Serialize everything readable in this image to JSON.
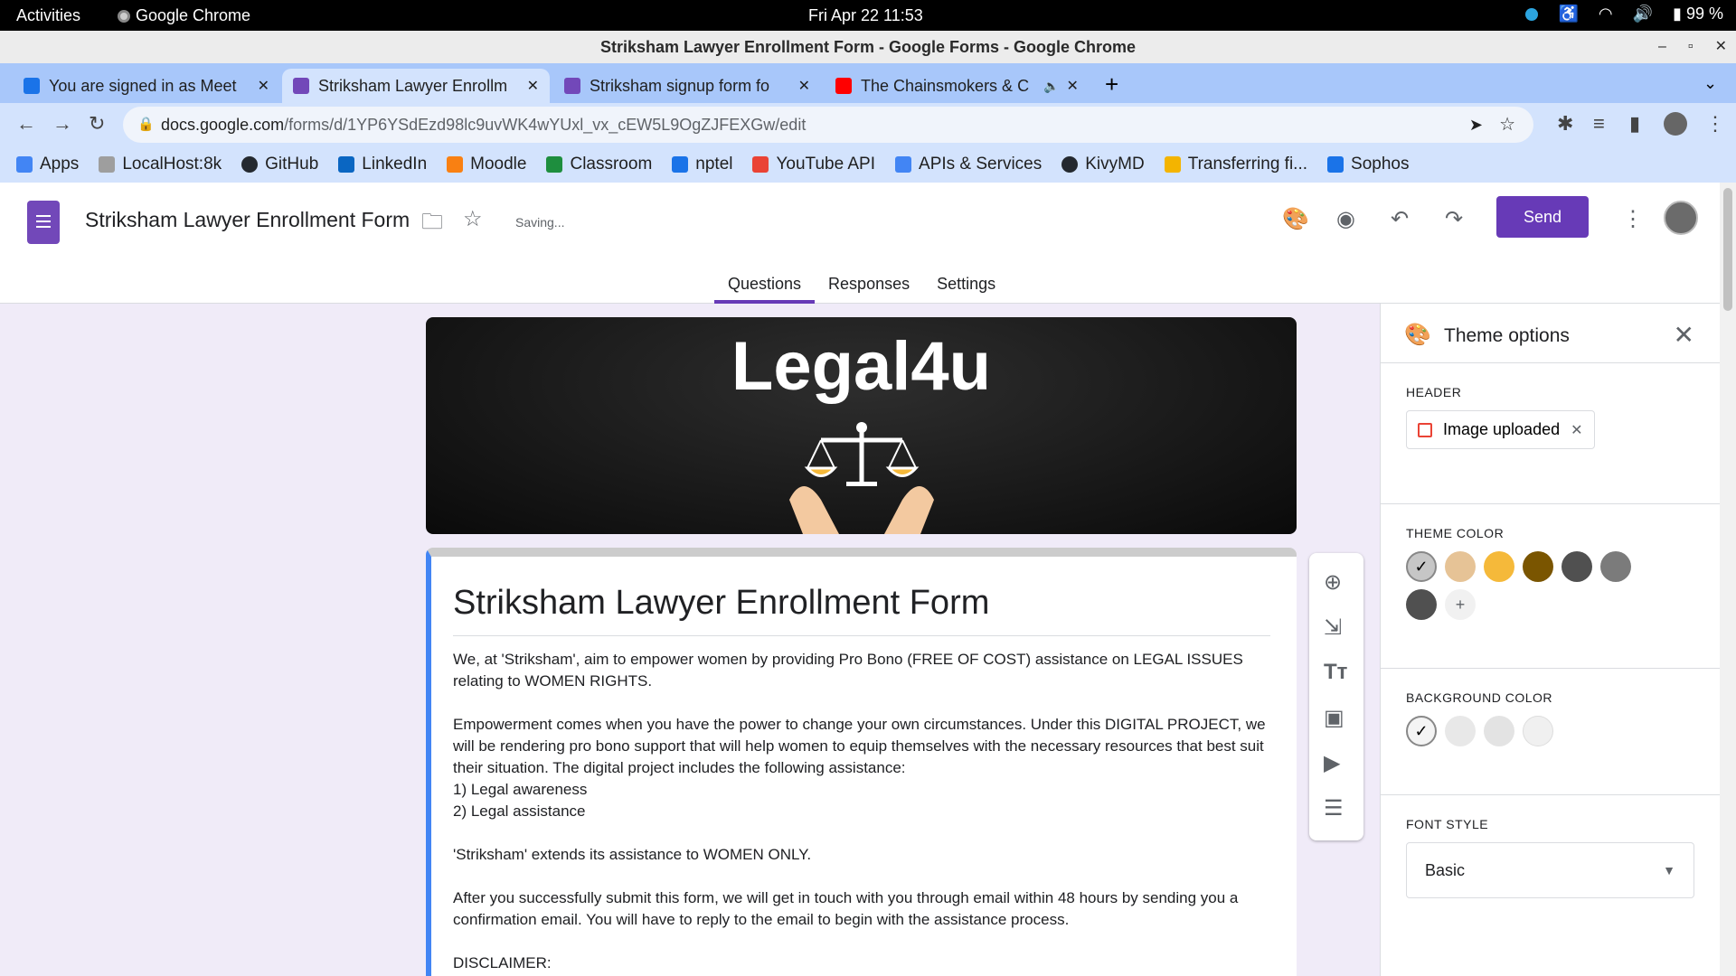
{
  "system": {
    "activities": "Activities",
    "app": "Google Chrome",
    "clock": "Fri Apr 22  11:53",
    "battery": "99 %"
  },
  "window": {
    "title": "Striksham Lawyer Enrollment Form - Google Forms - Google Chrome"
  },
  "tabs": [
    {
      "label": "You are signed in as Meet",
      "icon": "sophos-icon",
      "color": "#1a73e8"
    },
    {
      "label": "Striksham Lawyer Enrollm",
      "icon": "forms-icon",
      "color": "#7248b9"
    },
    {
      "label": "Striksham signup form fo",
      "icon": "forms-icon",
      "color": "#7248b9"
    },
    {
      "label": "The Chainsmokers & C",
      "icon": "youtube-icon",
      "color": "#ff0000"
    }
  ],
  "address": {
    "domain": "docs.google.com",
    "path": "/forms/d/1YP6YSdEzd98lc9uvWK4wYUxl_vx_cEW5L9OgZJFEXGw/edit"
  },
  "bookmarks": [
    {
      "label": "Apps",
      "color": "#4285f4"
    },
    {
      "label": "LocalHost:8k",
      "color": "#9e9e9e"
    },
    {
      "label": "GitHub",
      "color": "#24292f"
    },
    {
      "label": "LinkedIn",
      "color": "#0a66c2"
    },
    {
      "label": "Moodle",
      "color": "#f98012"
    },
    {
      "label": "Classroom",
      "color": "#1e8e3e"
    },
    {
      "label": "nptel",
      "color": "#1a73e8"
    },
    {
      "label": "YouTube API",
      "color": "#ea4335"
    },
    {
      "label": "APIs & Services",
      "color": "#4285f4"
    },
    {
      "label": "KivyMD",
      "color": "#24292f"
    },
    {
      "label": "Transferring fi...",
      "color": "#f4b400"
    },
    {
      "label": "Sophos",
      "color": "#1a73e8"
    }
  ],
  "forms_header": {
    "title": "Striksham Lawyer Enrollment Form",
    "status": "Saving...",
    "send": "Send",
    "tabs": [
      "Questions",
      "Responses",
      "Settings"
    ],
    "active_tab": "Questions"
  },
  "banner": {
    "text": "Legal4u"
  },
  "form": {
    "title": "Striksham Lawyer Enrollment Form",
    "paragraphs": [
      "We, at 'Striksham', aim to empower women by providing Pro Bono (FREE OF COST) assistance on LEGAL ISSUES relating to WOMEN RIGHTS.",
      "Empowerment comes when you have the power to change your own circumstances. Under this DIGITAL PROJECT, we will be rendering pro bono support that will help women to equip themselves with the necessary resources that best suit their situation. The digital project includes the following assistance:",
      "1)    Legal awareness",
      "2)    Legal assistance",
      "'Striksham' extends its assistance to WOMEN ONLY.",
      "After you successfully submit this form, we will get in touch with you through email within 48 hours by sending you a confirmation email. You will have to reply to the email to begin with the assistance process.",
      "DISCLAIMER:"
    ]
  },
  "theme_panel": {
    "title": "Theme options",
    "header_label": "HEADER",
    "header_chip": "Image uploaded",
    "theme_color_label": "THEME COLOR",
    "theme_colors": [
      "#c6c6c6",
      "#e6c396",
      "#f5b93a",
      "#7a5500",
      "#505050",
      "#7b7b7b",
      "#505050"
    ],
    "background_color_label": "BACKGROUND COLOR",
    "background_colors": [
      "#f4f4f4",
      "#e8e8e8",
      "#e3e3e3",
      "#f0f0f0"
    ],
    "font_style_label": "FONT STYLE",
    "font_style_value": "Basic"
  }
}
